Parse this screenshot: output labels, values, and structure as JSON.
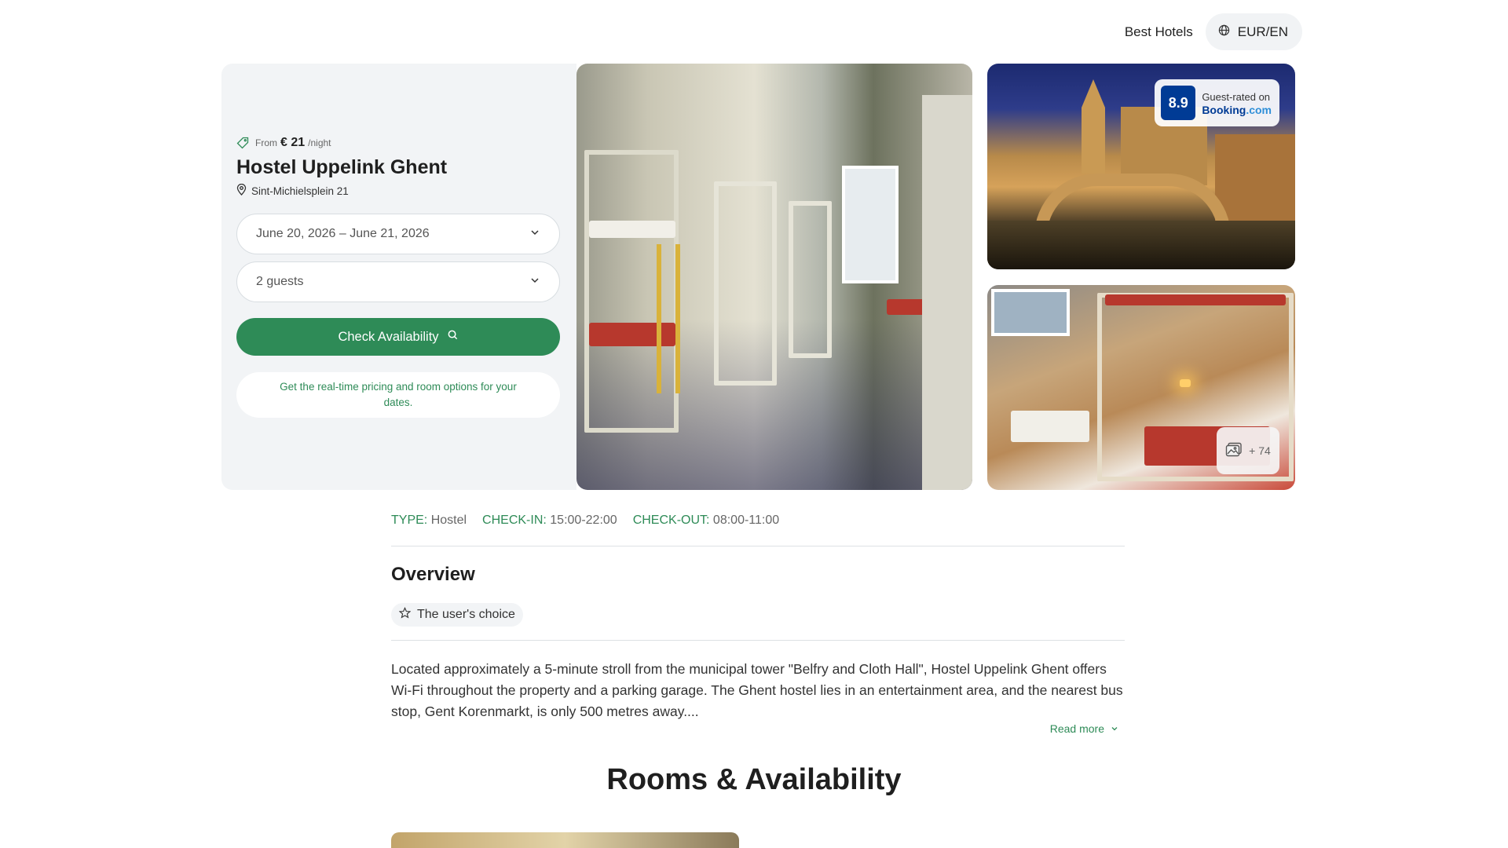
{
  "header": {
    "brand": "Best Hotels",
    "currency_language": "EUR/EN"
  },
  "booking_panel": {
    "price_prefix": "From",
    "price": "€ 21",
    "price_suffix": "/night",
    "hotel_name": "Hostel Uppelink Ghent",
    "address": "Sint-Michielsplein 21",
    "dates_value": "June 20, 2026 – June 21, 2026",
    "guests_value": "2 guests",
    "cta_label": "Check Availability",
    "hint": "Get the real-time pricing and room options for your dates."
  },
  "gallery": {
    "rating_score": "8.9",
    "rating_label": "Guest-rated on",
    "rating_brand_main": "Booking",
    "rating_brand_suffix": ".com",
    "more_photos": "+ 74"
  },
  "meta": {
    "type_key": "TYPE",
    "type_value": "Hostel",
    "checkin_key": "CHECK-IN",
    "checkin_value": "15:00-22:00",
    "checkout_key": "CHECK-OUT",
    "checkout_value": "08:00-11:00"
  },
  "overview": {
    "title": "Overview",
    "chip_label": "The user's choice",
    "description": "Located approximately a 5-minute stroll from the municipal tower \"Belfry and Cloth Hall\", Hostel Uppelink Ghent offers Wi-Fi throughout the property and a parking garage. The Ghent hostel lies in an entertainment area, and the nearest bus stop, Gent Korenmarkt, is only 500 metres away....",
    "read_more": "Read more"
  },
  "rooms": {
    "title": "Rooms & Availability"
  },
  "colors": {
    "accent_green": "#2e8b57",
    "booking_blue": "#003b95",
    "panel_bg": "#f2f4f6"
  },
  "icons": [
    "globe-icon",
    "price-tag-icon",
    "location-pin-icon",
    "chevron-down-icon",
    "search-icon",
    "gallery-icon",
    "star-icon"
  ]
}
